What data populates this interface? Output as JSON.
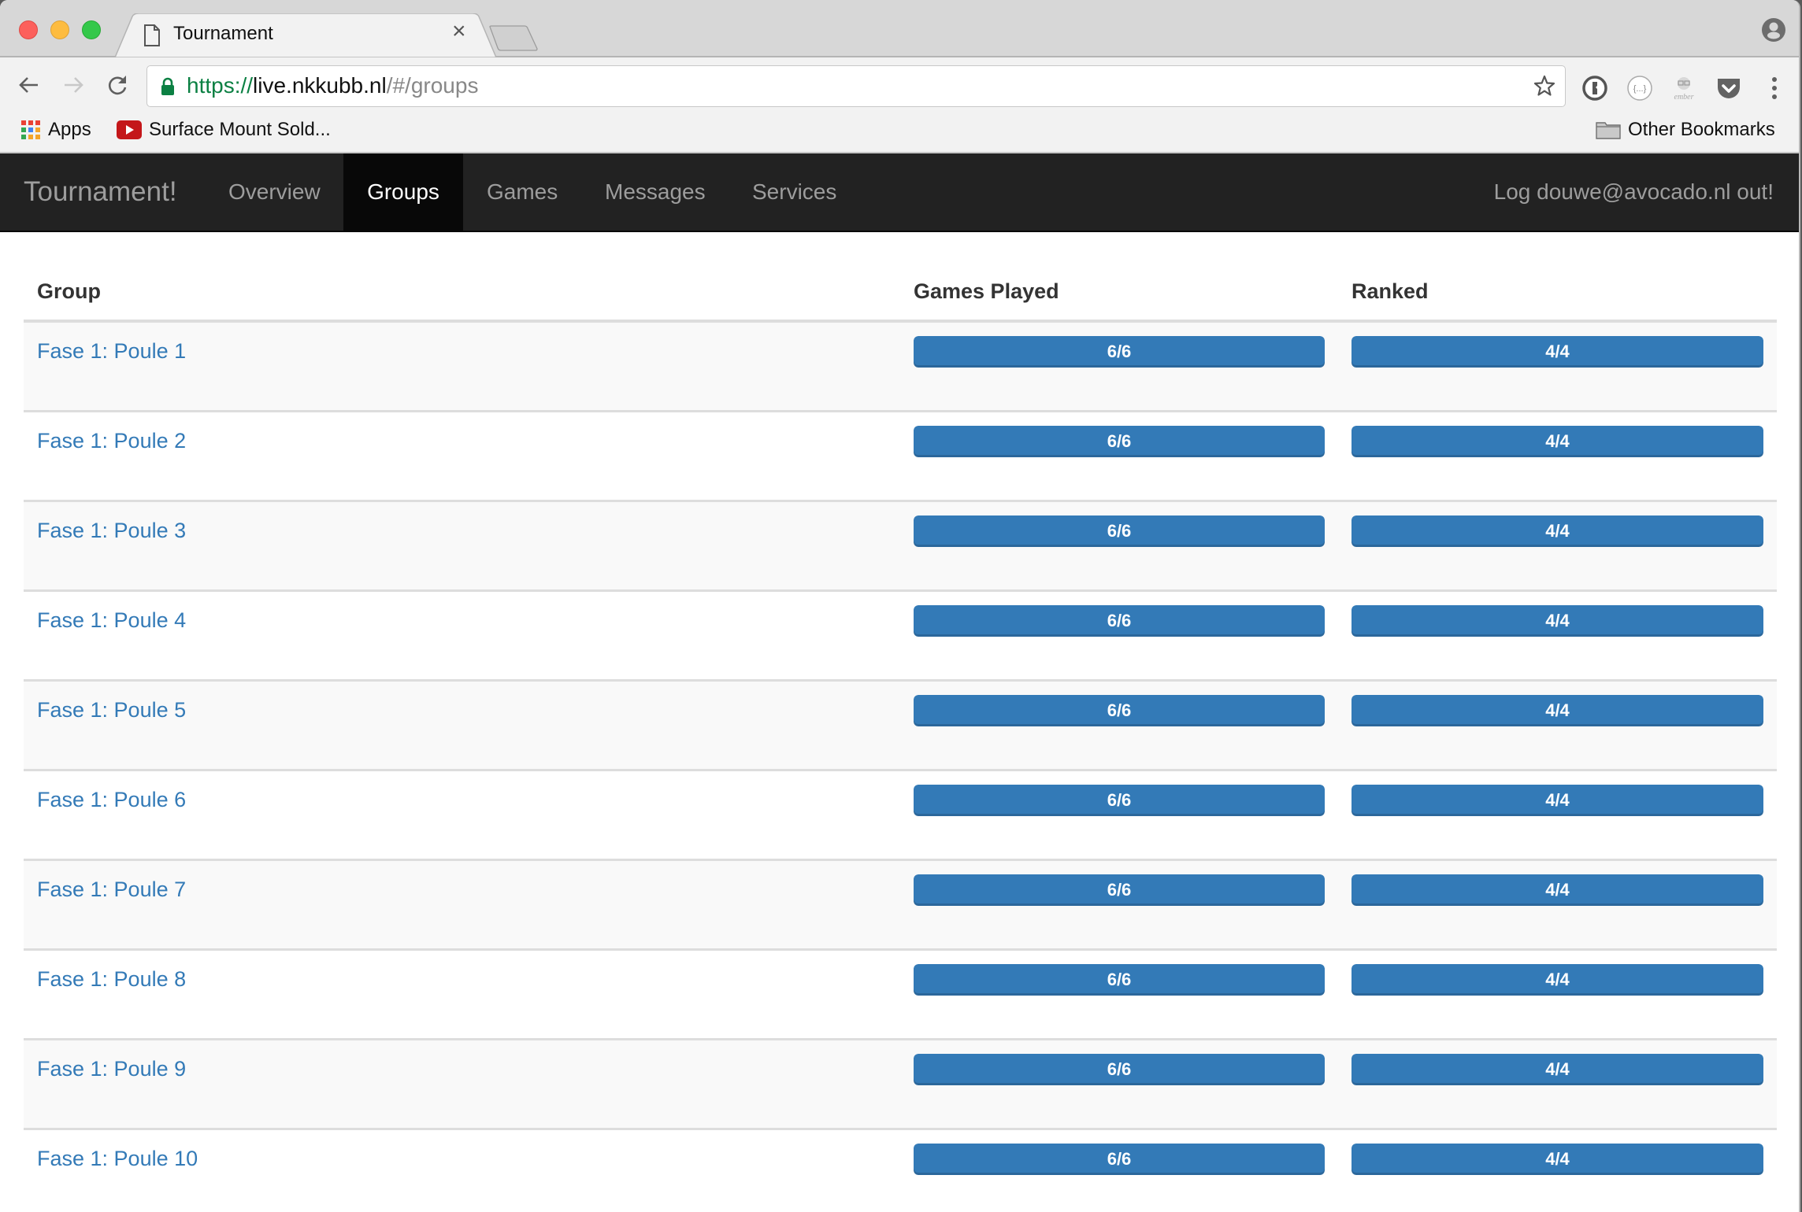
{
  "browser": {
    "tab_title": "Tournament",
    "url": {
      "scheme": "https://",
      "host": "live.nkkubb.nl",
      "path": "/#/groups"
    },
    "bookmarks": [
      {
        "label": "Apps",
        "icon": "apps-grid-icon"
      },
      {
        "label": "Surface Mount Sold...",
        "icon": "youtube-icon"
      }
    ],
    "other_bookmarks": "Other Bookmarks",
    "extensions": [
      "1password-icon",
      "json-viewer-icon",
      "ember-inspector-icon",
      "pocket-icon"
    ]
  },
  "app": {
    "brand": "Tournament!",
    "nav": [
      {
        "label": "Overview",
        "active": false
      },
      {
        "label": "Groups",
        "active": true
      },
      {
        "label": "Games",
        "active": false
      },
      {
        "label": "Messages",
        "active": false
      },
      {
        "label": "Services",
        "active": false
      }
    ],
    "logout": "Log douwe@avocado.nl out!",
    "accent_color": "#337ab7"
  },
  "table": {
    "headers": [
      "Group",
      "Games Played",
      "Ranked"
    ],
    "rows": [
      {
        "group": "Fase 1: Poule 1",
        "games_played": "6/6",
        "games_played_fraction": 1.0,
        "ranked": "4/4",
        "ranked_fraction": 1.0
      },
      {
        "group": "Fase 1: Poule 2",
        "games_played": "6/6",
        "games_played_fraction": 1.0,
        "ranked": "4/4",
        "ranked_fraction": 1.0
      },
      {
        "group": "Fase 1: Poule 3",
        "games_played": "6/6",
        "games_played_fraction": 1.0,
        "ranked": "4/4",
        "ranked_fraction": 1.0
      },
      {
        "group": "Fase 1: Poule 4",
        "games_played": "6/6",
        "games_played_fraction": 1.0,
        "ranked": "4/4",
        "ranked_fraction": 1.0
      },
      {
        "group": "Fase 1: Poule 5",
        "games_played": "6/6",
        "games_played_fraction": 1.0,
        "ranked": "4/4",
        "ranked_fraction": 1.0
      },
      {
        "group": "Fase 1: Poule 6",
        "games_played": "6/6",
        "games_played_fraction": 1.0,
        "ranked": "4/4",
        "ranked_fraction": 1.0
      },
      {
        "group": "Fase 1: Poule 7",
        "games_played": "6/6",
        "games_played_fraction": 1.0,
        "ranked": "4/4",
        "ranked_fraction": 1.0
      },
      {
        "group": "Fase 1: Poule 8",
        "games_played": "6/6",
        "games_played_fraction": 1.0,
        "ranked": "4/4",
        "ranked_fraction": 1.0
      },
      {
        "group": "Fase 1: Poule 9",
        "games_played": "6/6",
        "games_played_fraction": 1.0,
        "ranked": "4/4",
        "ranked_fraction": 1.0
      },
      {
        "group": "Fase 1: Poule 10",
        "games_played": "6/6",
        "games_played_fraction": 1.0,
        "ranked": "4/4",
        "ranked_fraction": 1.0
      }
    ]
  }
}
